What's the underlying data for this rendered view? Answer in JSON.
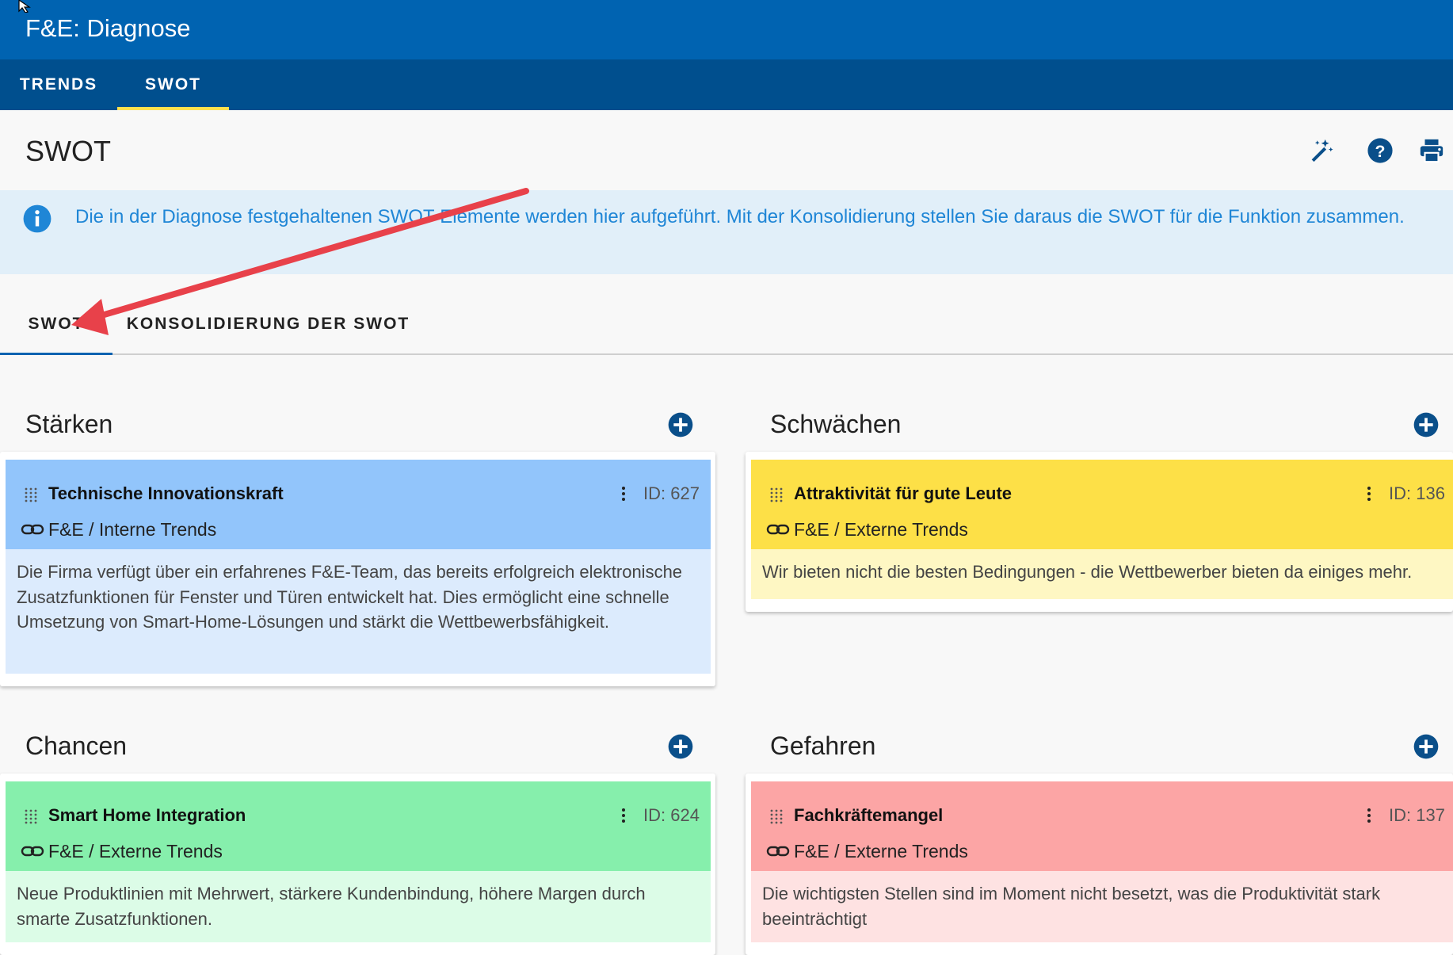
{
  "app": {
    "title": "F&E: Diagnose"
  },
  "main_tabs": [
    {
      "label": "TRENDS",
      "active": false
    },
    {
      "label": "SWOT",
      "active": true
    }
  ],
  "page": {
    "title": "SWOT"
  },
  "toolbar": {
    "icons": [
      "magic-wand-icon",
      "help-icon",
      "print-icon"
    ]
  },
  "info": {
    "text": "Die in der Diagnose festgehaltenen SWOT-Elemente werden hier aufgeführt. Mit der Konsolidierung stellen Sie daraus die SWOT für die Funktion zusammen."
  },
  "sub_tabs": [
    {
      "label": "SWOT",
      "active": true
    },
    {
      "label": "KONSOLIDIERUNG DER SWOT",
      "active": false
    }
  ],
  "sections": {
    "staerken": {
      "title": "Stärken",
      "card": {
        "title": "Technische Innovationskraft",
        "id": "ID: 627",
        "link": "F&E / Interne Trends",
        "description": "Die Firma verfügt über ein erfahrenes F&E-Team, das bereits erfolgreich elektronische Zusatzfunktionen für Fenster und Türen entwickelt hat. Dies ermöglicht eine schnelle Umsetzung von Smart-Home-Lösungen und stärkt die Wettbewerbsfähigkeit.",
        "head_color": "#92c5fb",
        "body_color": "#dcebfd"
      }
    },
    "schwaechen": {
      "title": "Schwächen",
      "card": {
        "title": "Attraktivität für gute Leute",
        "id": "ID: 136",
        "link": "F&E / Externe Trends",
        "description": "Wir bieten nicht die besten Bedingungen - die Wettbewerber bieten da einiges mehr.",
        "head_color": "#fde047",
        "body_color": "#fef7c3"
      }
    },
    "chancen": {
      "title": "Chancen",
      "card": {
        "title": "Smart Home Integration",
        "id": "ID: 624",
        "link": "F&E / Externe Trends",
        "description": "Neue Produktlinien mit Mehrwert, stärkere Kundenbindung, höhere Margen durch smarte Zusatzfunktionen.",
        "head_color": "#86efac",
        "body_color": "#dcfce7"
      }
    },
    "gefahren": {
      "title": "Gefahren",
      "card": {
        "title": "Fachkräftemangel",
        "id": "ID: 137",
        "link": "F&E / Externe Trends",
        "description": "Die wichtigsten Stellen sind im Moment nicht besetzt, was die Produktivität stark beeinträchtigt",
        "head_color": "#fca5a5",
        "body_color": "#fee2e2"
      }
    }
  },
  "colors": {
    "app_bar": "#0063b1",
    "tab_bar": "#004f8e",
    "tab_indicator": "#ffe14d",
    "info_bg": "#e1eff9",
    "info_text": "#1f86d6",
    "accent_button": "#0a4f8a",
    "annotation_arrow": "#e8414a"
  }
}
